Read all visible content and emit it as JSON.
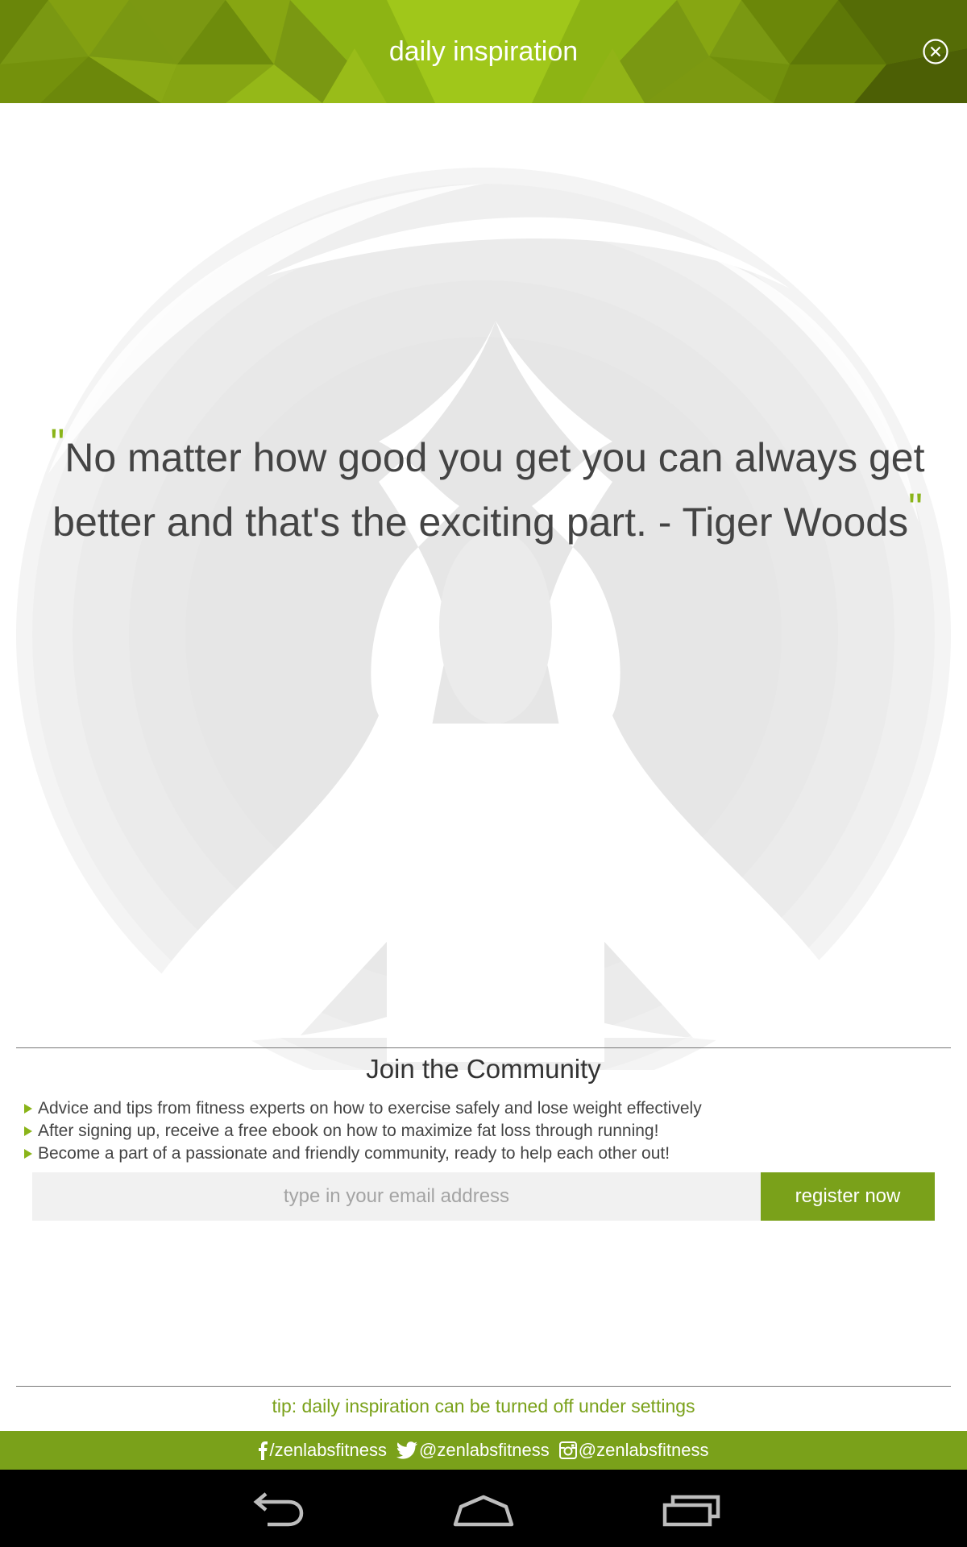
{
  "header": {
    "title": "daily inspiration",
    "close_icon": "close-circle-icon",
    "colors": [
      "#5f7d08",
      "#9cc21a",
      "#4a5a05"
    ]
  },
  "quote": {
    "open_mark": "\"",
    "text": "No matter how good you get you can always get better and that's the exciting part. - Tiger Woods",
    "close_mark": "\""
  },
  "community": {
    "title": "Join the Community",
    "benefits": [
      "Advice and tips from fitness experts on how to exercise safely and lose weight effectively",
      "After signing up, receive a free ebook on how to maximize fat loss through running!",
      "Become a part of a passionate and friendly community, ready to help each other out!"
    ],
    "email_placeholder": "type in your email address",
    "register_label": "register now"
  },
  "tip": "tip: daily inspiration can be turned off under settings",
  "social": {
    "facebook": "/zenlabsfitness",
    "twitter": "@zenlabsfitness",
    "instagram": "@zenlabsfitness"
  },
  "accent_color": "#7aa11a",
  "nav": {
    "icons": [
      "back-icon",
      "home-icon",
      "recent-apps-icon"
    ]
  }
}
